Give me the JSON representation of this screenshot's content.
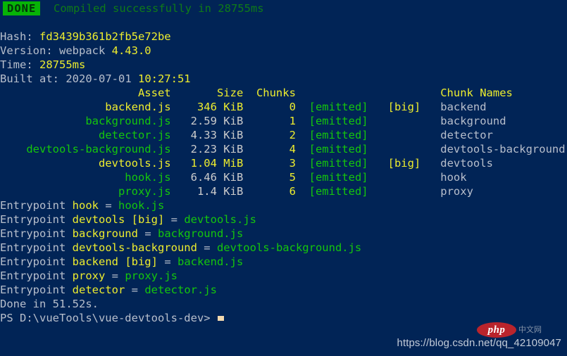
{
  "terminal": {
    "background_color": "#012456",
    "prompt_cwd": "PS D:\\vueTools\\vue-devtools-dev>",
    "status_badge": {
      "label": "DONE",
      "bg_color": "#07b307",
      "text_color": "#04320a"
    },
    "status_message": "Compiled successfully in 28755ms",
    "info": {
      "hash_label": "Hash: ",
      "hash_value": "fd3439b361b2fb5e72be",
      "version_label": "Version: webpack ",
      "version_value": "4.43.0",
      "time_label": "Time: ",
      "time_value": "28755ms",
      "built_label": "Built at: ",
      "built_date": "2020-07-01 ",
      "built_time": "10:27:51"
    },
    "table": {
      "headers": {
        "asset": "Asset",
        "size": "Size",
        "chunks": "Chunks",
        "chunk_names": "Chunk Names"
      },
      "rows": [
        {
          "asset": "backend.js",
          "size": "346 KiB",
          "chunks": "0",
          "emitted": "[emitted]",
          "big": "[big]",
          "chunk_name": "backend",
          "is_big": true
        },
        {
          "asset": "background.js",
          "size": "2.59 KiB",
          "chunks": "1",
          "emitted": "[emitted]",
          "big": "",
          "chunk_name": "background",
          "is_big": false
        },
        {
          "asset": "detector.js",
          "size": "4.33 KiB",
          "chunks": "2",
          "emitted": "[emitted]",
          "big": "",
          "chunk_name": "detector",
          "is_big": false
        },
        {
          "asset": "devtools-background.js",
          "size": "2.23 KiB",
          "chunks": "4",
          "emitted": "[emitted]",
          "big": "",
          "chunk_name": "devtools-background",
          "is_big": false
        },
        {
          "asset": "devtools.js",
          "size": "1.04 MiB",
          "chunks": "3",
          "emitted": "[emitted]",
          "big": "[big]",
          "chunk_name": "devtools",
          "is_big": true
        },
        {
          "asset": "hook.js",
          "size": "6.46 KiB",
          "chunks": "5",
          "emitted": "[emitted]",
          "big": "",
          "chunk_name": "hook",
          "is_big": false
        },
        {
          "asset": "proxy.js",
          "size": "1.4 KiB",
          "chunks": "6",
          "emitted": "[emitted]",
          "big": "",
          "chunk_name": "proxy",
          "is_big": false
        }
      ]
    },
    "entrypoints": {
      "keyword": "Entrypoint",
      "items": [
        {
          "name": "hook",
          "big": "",
          "file": "hook.js"
        },
        {
          "name": "devtools",
          "big": "[big]",
          "file": "devtools.js"
        },
        {
          "name": "background",
          "big": "",
          "file": "background.js"
        },
        {
          "name": "devtools-background",
          "big": "",
          "file": "devtools-background.js"
        },
        {
          "name": "backend",
          "big": "[big]",
          "file": "backend.js"
        },
        {
          "name": "proxy",
          "big": "",
          "file": "proxy.js"
        },
        {
          "name": "detector",
          "big": "",
          "file": "detector.js"
        }
      ]
    },
    "done_line": "Done in 51.52s."
  },
  "watermark": {
    "url": "https://blog.csdn.net/qq_42109047",
    "logo_text": "php",
    "logo_sub": "中文网",
    "logo_color": "#b9242c"
  }
}
